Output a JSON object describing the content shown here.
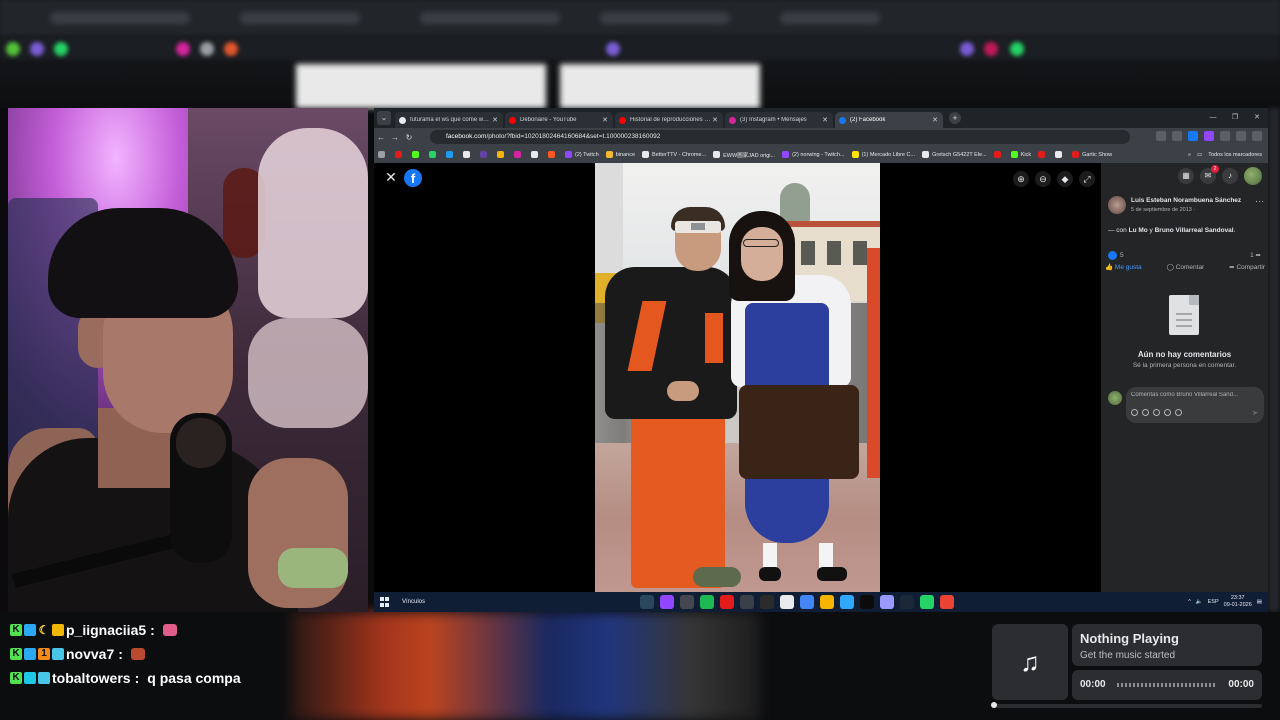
{
  "browser": {
    "tabs": [
      {
        "title": "futurama el ws que come wo...",
        "color": "#e8eaed",
        "active": false
      },
      {
        "title": "Debonaire - YouTube",
        "color": "#ff0000",
        "active": false
      },
      {
        "title": "Historial de reproducciones - Y...",
        "color": "#ff0000",
        "active": false
      },
      {
        "title": "(3) Instagram • Mensajes",
        "color": "#d6249f",
        "active": false
      },
      {
        "title": "(2) Facebook",
        "color": "#1877f2",
        "active": true
      }
    ],
    "url_host": "facebook.com",
    "url_path": "/photo/?fbid=10201802464160684&set=t.100000238160092",
    "bookmarks": [
      {
        "label": "",
        "color": "#e21b1b"
      },
      {
        "label": "",
        "color": "#53fc18"
      },
      {
        "label": "",
        "color": "#25d366"
      },
      {
        "label": "",
        "color": "#1d9bf0"
      },
      {
        "label": "",
        "color": "#e8eaed"
      },
      {
        "label": "",
        "color": "#6441a5"
      },
      {
        "label": "",
        "color": "#f4b400"
      },
      {
        "label": "",
        "color": "#d6249f"
      },
      {
        "label": "",
        "color": "#e8eaed"
      },
      {
        "label": "",
        "color": "#ff5722"
      },
      {
        "label": "(2) Twitch",
        "color": "#9146ff"
      },
      {
        "label": "binance",
        "color": "#f3ba2f"
      },
      {
        "label": "BetterTTV - Chrome...",
        "color": "#e8eaed"
      },
      {
        "label": "EWW圖家JAD origi...",
        "color": "#e8eaed"
      },
      {
        "label": "(2) norwing - Twitch...",
        "color": "#9146ff"
      },
      {
        "label": "(1) Mercado Libre C...",
        "color": "#ffe600"
      },
      {
        "label": "Gretsch G5422T Ele...",
        "color": "#e8eaed"
      },
      {
        "label": "",
        "color": "#e21b1b"
      },
      {
        "label": "Kick",
        "color": "#53fc18"
      },
      {
        "label": "",
        "color": "#e21b1b"
      },
      {
        "label": "",
        "color": "#e8eaed"
      },
      {
        "label": "Gartic Show",
        "color": "#e21b1b"
      }
    ],
    "bookmarks_all": "Todos los marcadores"
  },
  "facebook": {
    "author": "Luis Esteban Norambuena Sánchez",
    "date": "5 de septiembre de 2013 · ",
    "caption_prefix": "— con ",
    "caption_people": "Lu Mo",
    "caption_join": " y ",
    "caption_people2": "Bruno Villarreal Sandoval",
    "caption_end": ".",
    "likes_count": "5",
    "shares_count": "1",
    "action_like": "Me gusta",
    "action_comment": "Comentar",
    "action_share": "Compartir",
    "empty_title": "Aún no hay comentarios",
    "empty_sub": "Sé la primera persona en comentar.",
    "comment_placeholder": "Comentas como Bruno Villarreal Sand...",
    "notif_count": "2"
  },
  "taskbar": {
    "label": "Vínculos",
    "lang": "ESP",
    "time": "23:37",
    "date": "09-01-2026",
    "apps": [
      "#2a475e",
      "#9146ff",
      "#44474f",
      "#1db954",
      "#e21b1b",
      "#3a3f4a",
      "#2b2b2b",
      "#e8eaed",
      "#4285f4",
      "#f4b400",
      "#31a8ff",
      "#0b0b0b",
      "#9999ff",
      "#1b2838",
      "#25d366",
      "#ea4335"
    ]
  },
  "chat": {
    "messages": [
      {
        "user": "p_iignaciia5",
        "text": ""
      },
      {
        "user": "novva7",
        "text": ""
      },
      {
        "user": "tobaltowers",
        "text": "q pasa compa"
      }
    ]
  },
  "music": {
    "title": "Nothing Playing",
    "subtitle": "Get the music started",
    "time_start": "00:00",
    "time_end": "00:00",
    "progress": 0
  }
}
